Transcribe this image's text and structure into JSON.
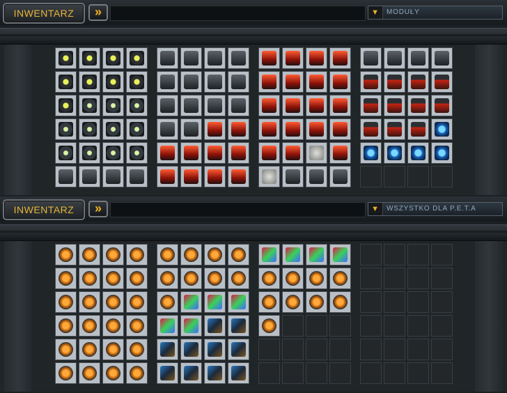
{
  "panels": [
    {
      "inventory_label": "INWENTARZ",
      "filter_value": "MODUŁY",
      "groups": [
        {
          "slots": [
            "yellow",
            "yellow",
            "yellow",
            "yellow",
            "yellow",
            "yellow",
            "yellow",
            "yellow",
            "yellow",
            "green",
            "green",
            "green",
            "green",
            "green",
            "green",
            "green",
            "green",
            "green",
            "green",
            "green",
            "gray",
            "gray",
            "gray",
            "gray"
          ]
        },
        {
          "slots": [
            "gray",
            "gray",
            "gray",
            "gray",
            "gray",
            "gray",
            "gray",
            "gray",
            "gray",
            "gray",
            "gray",
            "gray",
            "gray",
            "gray",
            "red",
            "red",
            "red",
            "red",
            "red",
            "red",
            "red",
            "red",
            "red",
            "red"
          ]
        },
        {
          "slots": [
            "red",
            "red",
            "red",
            "red",
            "red",
            "red",
            "red",
            "red",
            "red",
            "red",
            "red",
            "red",
            "red",
            "red",
            "red",
            "red",
            "red",
            "red",
            "stone",
            "red",
            "stone",
            "gray",
            "gray",
            "gray"
          ]
        },
        {
          "slots": [
            "gray",
            "gray",
            "gray",
            "gray",
            "mixred",
            "mixred",
            "mixred",
            "mixred",
            "mixred",
            "mixred",
            "mixred",
            "mixred",
            "mixred",
            "mixred",
            "mixred",
            "blue",
            "blue",
            "blue",
            "blue",
            "blue",
            "empty",
            "empty",
            "empty",
            "empty"
          ]
        }
      ]
    },
    {
      "inventory_label": "INWENTARZ",
      "filter_value": "WSZYSTKO DLA P.E.T.A",
      "groups": [
        {
          "slots": [
            "orange",
            "orange",
            "orange",
            "orange",
            "orange",
            "orange",
            "orange",
            "orange",
            "orange",
            "orange",
            "orange",
            "orange",
            "orange",
            "orange",
            "orange",
            "orange",
            "orange",
            "orange",
            "orange",
            "orange",
            "orange",
            "orange",
            "orange",
            "orange"
          ]
        },
        {
          "slots": [
            "orange",
            "orange",
            "orange",
            "orange",
            "orange",
            "orange",
            "orange",
            "orange",
            "orange",
            "colored",
            "colored",
            "colored",
            "colored",
            "colored",
            "drone",
            "drone",
            "drone",
            "drone",
            "drone",
            "drone",
            "drone",
            "drone",
            "drone",
            "drone"
          ]
        },
        {
          "slots": [
            "colored",
            "colored",
            "colored",
            "colored",
            "orange",
            "orange",
            "orange",
            "orange",
            "orange",
            "orange",
            "orange",
            "orange",
            "orange",
            "empty",
            "empty",
            "empty",
            "empty",
            "empty",
            "empty",
            "empty",
            "empty",
            "empty",
            "empty",
            "empty"
          ]
        },
        {
          "slots": [
            "empty",
            "empty",
            "empty",
            "empty",
            "empty",
            "empty",
            "empty",
            "empty",
            "empty",
            "empty",
            "empty",
            "empty",
            "empty",
            "empty",
            "empty",
            "empty",
            "empty",
            "empty",
            "empty",
            "empty",
            "empty",
            "empty",
            "empty",
            "empty"
          ]
        }
      ]
    }
  ],
  "icons": {
    "arrow_button": "»",
    "dropdown": "▼"
  }
}
